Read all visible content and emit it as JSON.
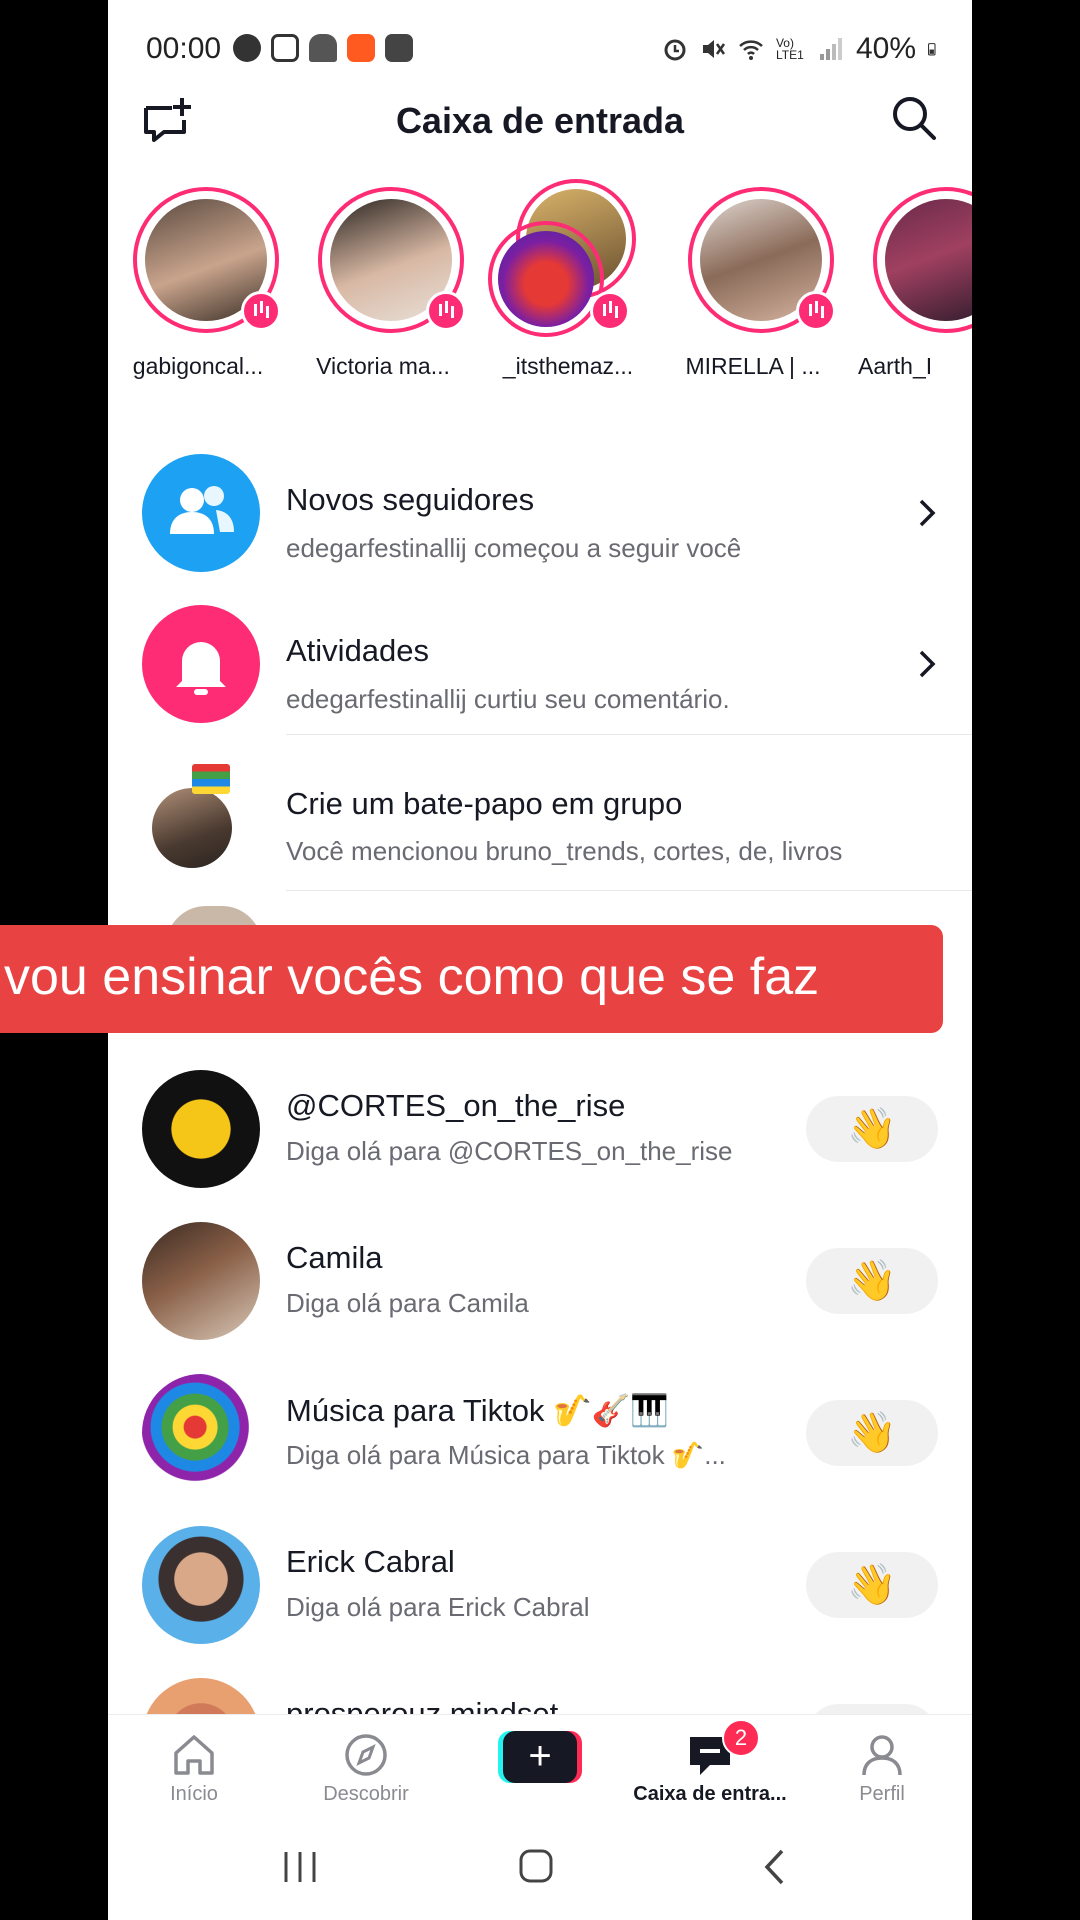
{
  "status_bar": {
    "time": "00:00",
    "battery": "40%",
    "network": "Vo) LTE1"
  },
  "header": {
    "title": "Caixa de entrada"
  },
  "stories": [
    {
      "name": "gabigoncal..."
    },
    {
      "name": "Victoria ma..."
    },
    {
      "name": "_itsthemaz..."
    },
    {
      "name": "MIRELLA | ..."
    },
    {
      "name": "Aarth_I"
    }
  ],
  "notifications": [
    {
      "title": "Novos seguidores",
      "subtitle": "edegarfestinallij começou a seguir você"
    },
    {
      "title": "Atividades",
      "subtitle": "edegarfestinallij curtiu seu comentário."
    }
  ],
  "group_chat": {
    "title": "Crie um bate-papo em grupo",
    "subtitle": "Você mencionou bruno_trends, cortes, de, livros"
  },
  "caption": "vou ensinar vocês como que se faz",
  "suggestions": [
    {
      "title": "@CORTES_on_the_rise",
      "subtitle": "Diga olá para @CORTES_on_the_rise"
    },
    {
      "title": "Camila",
      "subtitle": "Diga olá para Camila"
    },
    {
      "title": "Música para Tiktok 🎷🎸🎹",
      "subtitle": "Diga olá para Música para Tiktok 🎷..."
    },
    {
      "title": "Erick Cabral",
      "subtitle": "Diga olá para Erick Cabral"
    },
    {
      "title": "prosperouz.mindset",
      "subtitle": ""
    }
  ],
  "wave_emoji": "👋",
  "bottom_nav": {
    "home": "Início",
    "discover": "Descobrir",
    "inbox": "Caixa de entra...",
    "profile": "Perfil",
    "inbox_badge": "2",
    "plus_symbol": "+"
  },
  "colors": {
    "accent": "#fe2c55",
    "followers_icon": "#1da1f2",
    "activity_icon": "#fe2c75",
    "caption_bg": "#e94242"
  }
}
